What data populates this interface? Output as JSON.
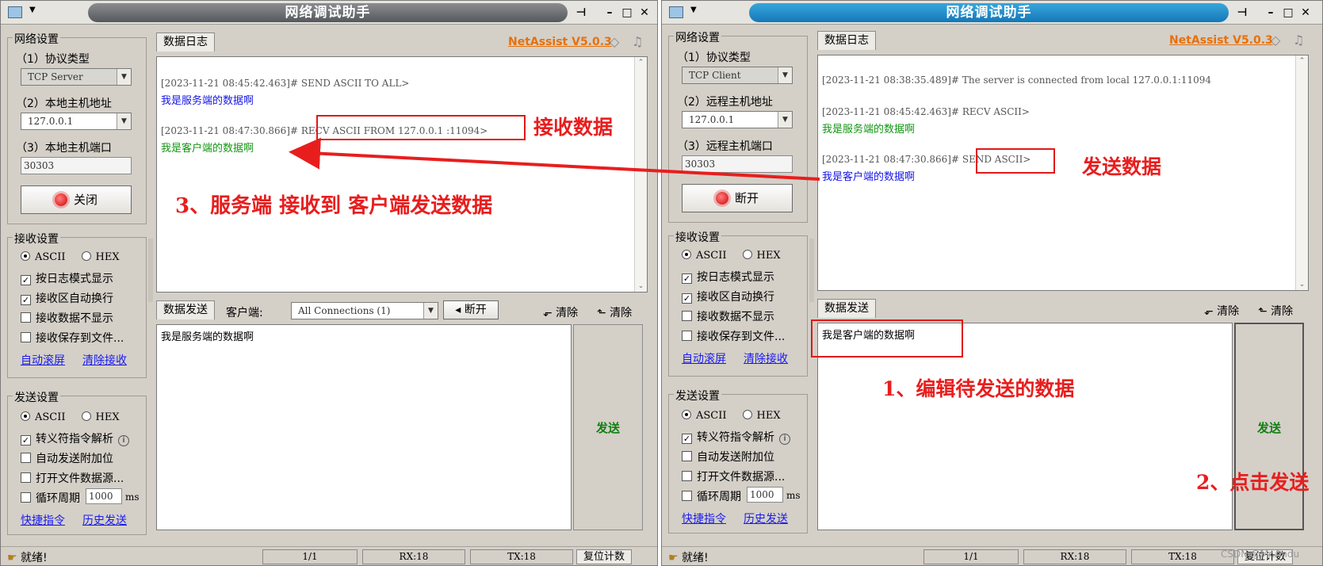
{
  "windows": [
    {
      "title": "网络调试助手",
      "brand": "NetAssist V5.0.3",
      "net_settings": {
        "group_title": "网络设置",
        "protocol_label": "（1）协议类型",
        "protocol_value": "TCP Server",
        "host_label": "（2）本地主机地址",
        "host_value": "127.0.0.1",
        "port_label": "（3）本地主机端口",
        "port_value": "30303",
        "connect_button": "关闭"
      },
      "recv_settings": {
        "group_title": "接收设置",
        "ascii": "ASCII",
        "hex": "HEX",
        "opt1": "按日志模式显示",
        "opt2": "接收区自动换行",
        "opt3": "接收数据不显示",
        "opt4": "接收保存到文件...",
        "link1": "自动滚屏",
        "link2": "清除接收"
      },
      "send_settings": {
        "group_title": "发送设置",
        "ascii": "ASCII",
        "hex": "HEX",
        "opt1": "转义符指令解析",
        "opt2": "自动发送附加位",
        "opt3": "打开文件数据源...",
        "opt4": "循环周期",
        "period_value": "1000",
        "period_unit": "ms",
        "link1": "快捷指令",
        "link2": "历史发送"
      },
      "log_tab": "数据日志",
      "log": [
        {
          "ts": "[2023-11-21 08:45:42.463]#",
          "msg": "SEND ASCII TO ALL>",
          "data": "我是服务端的数据啊"
        },
        {
          "ts": "[2023-11-21 08:47:30.866]#",
          "msg": "RECV ASCII FROM 127.0.0.1 :11094>",
          "data": "我是客户端的数据啊"
        }
      ],
      "send_tab": "数据发送",
      "client_label": "客户端:",
      "client_value": "All Connections (1)",
      "disconnect_button": "断开",
      "clear1": "清除",
      "clear2": "清除",
      "send_text": "我是服务端的数据啊",
      "send_button": "发送",
      "status": {
        "ready": "就绪!",
        "count": "1/1",
        "rx": "RX:18",
        "tx": "TX:18",
        "reset": "复位计数"
      },
      "annotations": {
        "recv": "接收数据",
        "server_received": "3、服务端 接收到 客户端发送数据"
      }
    },
    {
      "title": "网络调试助手",
      "brand": "NetAssist V5.0.3",
      "net_settings": {
        "group_title": "网络设置",
        "protocol_label": "（1）协议类型",
        "protocol_value": "TCP Client",
        "host_label": "（2）远程主机地址",
        "host_value": "127.0.0.1",
        "port_label": "（3）远程主机端口",
        "port_value": "30303",
        "connect_button": "断开"
      },
      "recv_settings": {
        "group_title": "接收设置",
        "ascii": "ASCII",
        "hex": "HEX",
        "opt1": "按日志模式显示",
        "opt2": "接收区自动换行",
        "opt3": "接收数据不显示",
        "opt4": "接收保存到文件...",
        "link1": "自动滚屏",
        "link2": "清除接收"
      },
      "send_settings": {
        "group_title": "发送设置",
        "ascii": "ASCII",
        "hex": "HEX",
        "opt1": "转义符指令解析",
        "opt2": "自动发送附加位",
        "opt3": "打开文件数据源...",
        "opt4": "循环周期",
        "period_value": "1000",
        "period_unit": "ms",
        "link1": "快捷指令",
        "link2": "历史发送"
      },
      "log_tab": "数据日志",
      "log": [
        {
          "ts": "[2023-11-21 08:38:35.489]#",
          "msg": "The server is connected from local 127.0.0.1:11094",
          "data": ""
        },
        {
          "ts": "[2023-11-21 08:45:42.463]#",
          "msg": "RECV ASCII>",
          "data": "我是服务端的数据啊"
        },
        {
          "ts": "[2023-11-21 08:47:30.866]#",
          "msg": "SEND ASCII>",
          "data": "我是客户端的数据啊"
        }
      ],
      "send_tab": "数据发送",
      "clear1": "清除",
      "clear2": "清除",
      "send_text": "我是客户端的数据啊",
      "send_button": "发送",
      "status": {
        "ready": "就绪!",
        "count": "1/1",
        "rx": "RX:18",
        "tx": "TX:18",
        "reset": "复位计数"
      },
      "annotations": {
        "send": "发送数据",
        "edit": "1、编辑待发送的数据",
        "click": "2、点击发送"
      }
    }
  ],
  "watermark": "CSDN @Mr.Andu"
}
